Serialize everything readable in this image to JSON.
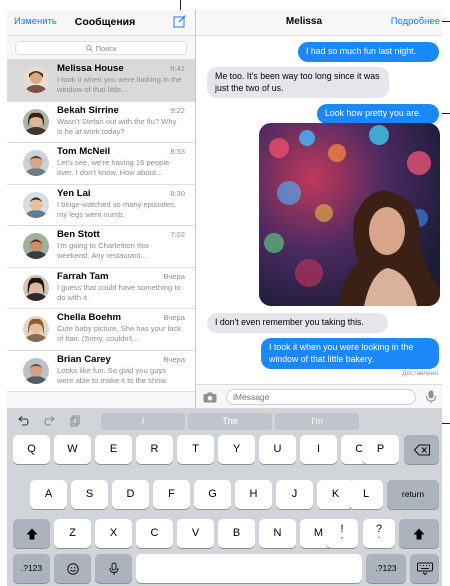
{
  "sidebar": {
    "edit_label": "Изменить",
    "title": "Сообщения",
    "search_placeholder": "Поиск",
    "conversations": [
      {
        "name": "Melissa House",
        "time": "9:41",
        "preview": "I took it when you were looking in the window of that little..."
      },
      {
        "name": "Bekah Sirrine",
        "time": "9:22",
        "preview": "Wasn't Stefan out with the flu? Why is he at work today?"
      },
      {
        "name": "Tom McNeil",
        "time": "8:53",
        "preview": "Let's see, we're having 16 people over. I don't know. How about..."
      },
      {
        "name": "Yen Lai",
        "time": "8:30",
        "preview": "I binge-watched so many episodes, my legs went numb."
      },
      {
        "name": "Ben Stott",
        "time": "7:02",
        "preview": "I'm going to Charleston this weekend. Any restaurant..."
      },
      {
        "name": "Farrah Tam",
        "time": "Вчера",
        "preview": "I guess that could have something to do with it."
      },
      {
        "name": "Chella Boehm",
        "time": "Вчера",
        "preview": "Cute baby picture. She has your lack of hair. (Sorry, couldn't..."
      },
      {
        "name": "Brian Carey",
        "time": "Вчера",
        "preview": "Looks like fun. So glad you guys were able to make it to the show."
      }
    ]
  },
  "chat": {
    "title": "Melissa",
    "details_label": "Подробнее",
    "messages": [
      {
        "text": "I had so much fun last night."
      },
      {
        "text": "Me too. It's been way too long since it was just the two of us."
      },
      {
        "text": "Look how pretty you are."
      },
      {
        "text": "I don't even remember you taking this."
      },
      {
        "text": "I took it when you were looking in the window of that little bakery."
      }
    ],
    "delivered_label": "Доставлено",
    "input_placeholder": "iMessage"
  },
  "keyboard": {
    "suggestions": [
      "I",
      "The",
      "I'm"
    ],
    "row1": [
      "Q",
      "W",
      "E",
      "R",
      "T",
      "Y",
      "U",
      "I",
      "O",
      "P"
    ],
    "row2": [
      "A",
      "S",
      "D",
      "F",
      "G",
      "H",
      "J",
      "K",
      "L"
    ],
    "row3": [
      "Z",
      "X",
      "C",
      "V",
      "B",
      "N",
      "M",
      "!",
      "?"
    ],
    "row3_sub": [
      ",",
      "."
    ],
    "return_label": "return",
    "numbers_label": ".?123"
  },
  "colors": {
    "accent": "#1a7cf2",
    "outgoing_bubble": "#1a88f7",
    "incoming_bubble": "#e6e5eb",
    "keyboard_bg": "#d1d4d9"
  }
}
